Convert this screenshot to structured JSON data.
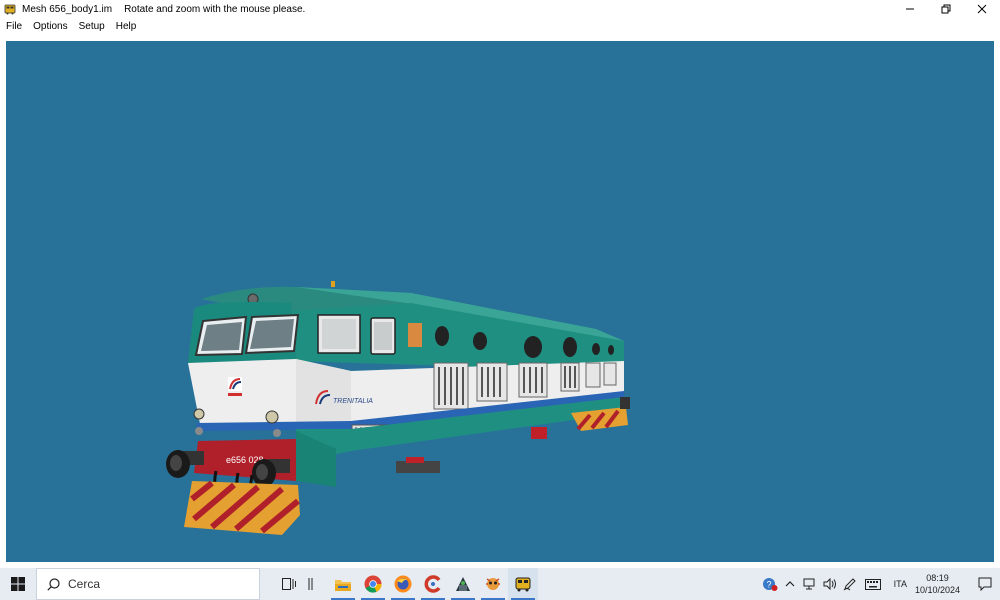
{
  "window": {
    "title": "Mesh 656_body1.im",
    "instruction": "Rotate and zoom with the mouse please."
  },
  "menu": {
    "items": [
      "File",
      "Options",
      "Setup",
      "Help"
    ]
  },
  "model": {
    "number_label": "e656  028",
    "brand_label": "TRENITALIA"
  },
  "taskbar": {
    "search_placeholder": "Cerca",
    "language": "ITA",
    "time": "08:19",
    "date": "10/10/2024"
  },
  "colors": {
    "viewport_bg": "#28729a",
    "loco_green": "#1f8f82",
    "loco_white": "#eeeeee",
    "loco_red": "#b0202a",
    "stripe_blue": "#2a64b4",
    "taskbar_bg": "#e6ecf2"
  },
  "icons": [
    "app-icon",
    "minimize-icon",
    "restore-icon",
    "close-icon",
    "windows-start-icon",
    "search-icon",
    "task-view-icon",
    "file-explorer-icon",
    "chrome-icon",
    "firefox-icon",
    "ccleaner-icon",
    "app-icon-2",
    "app-icon-3",
    "train-app-icon",
    "help-icon",
    "chevron-up-icon",
    "network-icon",
    "volume-icon",
    "pen-icon",
    "keyboard-icon",
    "notification-icon"
  ]
}
